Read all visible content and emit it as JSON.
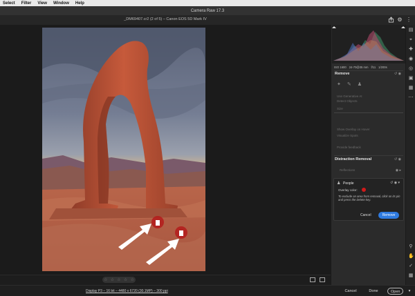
{
  "menubar": {
    "items": [
      "Select",
      "Filter",
      "View",
      "Window",
      "Help"
    ]
  },
  "app": {
    "title": "Camera Raw 17.3"
  },
  "header": {
    "file_title": "_DM69407.cr2 (2 of 5)  –  Canon EOS 5D Mark IV"
  },
  "exif": {
    "iso": "ISO 1600",
    "lens": "24-70@35 mm",
    "aperture": "f/11",
    "shutter": "1/200s"
  },
  "remove_panel": {
    "title": "Remove",
    "use_generative": "Use Generative AI",
    "detect_objects": "Detect Objects",
    "size": "Size",
    "show_overlay": "Show Overlay on Hover",
    "visualize_spots": "Visualize Spots",
    "provide_feedback": "Provide feedback"
  },
  "distraction_panel": {
    "title": "Distraction Removal",
    "reflections": "Reflections",
    "people": {
      "label": "People",
      "overlay_label": "Overlay color:",
      "overlay_color": "#d01a1a",
      "help_text": "To exclude an area from removal, click on its pin and press the Delete key.",
      "cancel_label": "Cancel",
      "remove_label": "Remove"
    }
  },
  "filmstrip": {
    "stars": [
      "☆",
      "☆",
      "☆",
      "☆",
      "☆"
    ]
  },
  "footer": {
    "info": "Display P3 – 16 bit – 4480 x 6720 (30.1MP) – 300 ppi",
    "cancel_label": "Cancel",
    "done_label": "Done",
    "open_label": "Open"
  },
  "colors": {
    "accent": "#2f7be0",
    "overlay": "#d01a1a"
  },
  "icons": [
    "share-icon",
    "gear-icon",
    "histogram-icon",
    "crop-icon",
    "heal-icon",
    "mask-icon",
    "redeye-icon",
    "presets-icon",
    "more-icon",
    "zoom-icon",
    "hand-icon",
    "sampler-icon",
    "grid-icon"
  ]
}
